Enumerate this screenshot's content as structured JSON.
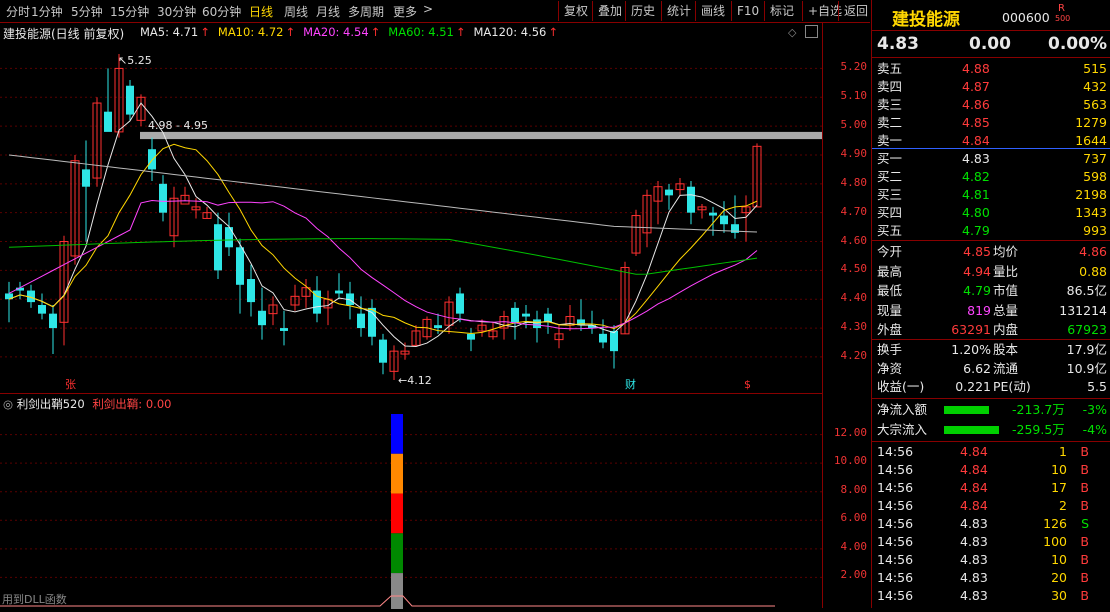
{
  "toolbar": {
    "periods": [
      "分时",
      "1分钟",
      "5分钟",
      "15分钟",
      "30分钟",
      "60分钟",
      "日线",
      "周线",
      "月线",
      "多周期",
      "更多"
    ],
    "active_period": "日线",
    "more_arrow": ">",
    "right_buttons": [
      "复权",
      "叠加",
      "历史",
      "统计",
      "画线",
      "F10",
      "标记",
      "+自选",
      "返回"
    ]
  },
  "chart": {
    "title": "建投能源(日线 前复权)",
    "ma": [
      {
        "label": "MA5: 4.71",
        "arrow": "↑",
        "color": "#e8e8e8"
      },
      {
        "label": "MA10: 4.72",
        "arrow": "↑",
        "color": "#ffd700"
      },
      {
        "label": "MA20: 4.54",
        "arrow": "↑",
        "color": "#ff44ff"
      },
      {
        "label": "MA60: 4.51",
        "arrow": "↑",
        "color": "#00e000"
      },
      {
        "label": "MA120: 4.56",
        "arrow": "↑",
        "color": "#e8e8e8"
      }
    ],
    "annotations": {
      "high": "5.25",
      "range": "4.98 - 4.95",
      "low": "4.12",
      "zhang": "张",
      "cai": "财",
      "dollar": "$"
    },
    "yticks": [
      "5.20",
      "5.10",
      "5.00",
      "4.90",
      "4.80",
      "4.70",
      "4.60",
      "4.50",
      "4.40",
      "4.30",
      "4.20"
    ],
    "ylim": [
      4.12,
      5.25
    ],
    "colors": {
      "up": "#ff3030",
      "down": "#2ee6e6",
      "band": "#aaaaaa"
    }
  },
  "indicator": {
    "title": "利剑出鞘520",
    "value": "利剑出鞘: 0.00",
    "footer": "用到DLL函数",
    "yticks": [
      "12.00",
      "10.00",
      "8.00",
      "6.00",
      "4.00",
      "2.00"
    ],
    "bar_colors": [
      "#0000ff",
      "#ff8800",
      "#ff0000",
      "#008800",
      "#888888"
    ]
  },
  "quote": {
    "name": "建投能源",
    "code": "000600",
    "r_badge": "R",
    "r_sub": "500",
    "price": "4.83",
    "change": "0.00",
    "pct": "0.00%",
    "asks": [
      {
        "label": "卖五",
        "price": "4.88",
        "vol": "515"
      },
      {
        "label": "卖四",
        "price": "4.87",
        "vol": "432"
      },
      {
        "label": "卖三",
        "price": "4.86",
        "vol": "563"
      },
      {
        "label": "卖二",
        "price": "4.85",
        "vol": "1279"
      },
      {
        "label": "卖一",
        "price": "4.84",
        "vol": "1644"
      }
    ],
    "bids": [
      {
        "label": "买一",
        "price": "4.83",
        "vol": "737",
        "pc": "wht"
      },
      {
        "label": "买二",
        "price": "4.82",
        "vol": "598",
        "pc": "green"
      },
      {
        "label": "买三",
        "price": "4.81",
        "vol": "2198",
        "pc": "green"
      },
      {
        "label": "买四",
        "price": "4.80",
        "vol": "1343",
        "pc": "green"
      },
      {
        "label": "买五",
        "price": "4.79",
        "vol": "993",
        "pc": "green"
      }
    ],
    "stats": [
      {
        "l1": "今开",
        "v1": "4.85",
        "c1": "red",
        "l2": "均价",
        "v2": "4.86",
        "c2": "red"
      },
      {
        "l1": "最高",
        "v1": "4.94",
        "c1": "red",
        "l2": "量比",
        "v2": "0.88",
        "c2": "yel"
      },
      {
        "l1": "最低",
        "v1": "4.79",
        "c1": "green",
        "l2": "市值",
        "v2": "86.5亿",
        "c2": "wht"
      },
      {
        "l1": "现量",
        "v1": "819",
        "c1": "mag",
        "l2": "总量",
        "v2": "131214",
        "c2": "wht"
      },
      {
        "l1": "外盘",
        "v1": "63291",
        "c1": "red",
        "l2": "内盘",
        "v2": "67923",
        "c2": "green"
      }
    ],
    "stats2": [
      {
        "l1": "换手",
        "v1": "1.20%",
        "l2": "股本",
        "v2": "17.9亿"
      },
      {
        "l1": "净资",
        "v1": "6.62",
        "l2": "流通",
        "v2": "10.9亿"
      },
      {
        "l1": "收益(一)",
        "v1": "0.221",
        "l2": "PE(动)",
        "v2": "5.5"
      }
    ],
    "flows": [
      {
        "label": "净流入额",
        "value": "-213.7万",
        "pct": "-3%",
        "frac": 0.45
      },
      {
        "label": "大宗流入",
        "value": "-259.5万",
        "pct": "-4%",
        "frac": 0.55
      }
    ],
    "ticks": [
      {
        "t": "14:56",
        "p": "4.84",
        "v": "1",
        "d": "B",
        "pc": "red"
      },
      {
        "t": "14:56",
        "p": "4.84",
        "v": "10",
        "d": "B",
        "pc": "red"
      },
      {
        "t": "14:56",
        "p": "4.84",
        "v": "17",
        "d": "B",
        "pc": "red"
      },
      {
        "t": "14:56",
        "p": "4.84",
        "v": "2",
        "d": "B",
        "pc": "red"
      },
      {
        "t": "14:56",
        "p": "4.83",
        "v": "126",
        "d": "S",
        "pc": "wht"
      },
      {
        "t": "14:56",
        "p": "4.83",
        "v": "100",
        "d": "B",
        "pc": "wht"
      },
      {
        "t": "14:56",
        "p": "4.83",
        "v": "10",
        "d": "B",
        "pc": "wht"
      },
      {
        "t": "14:56",
        "p": "4.83",
        "v": "20",
        "d": "B",
        "pc": "wht"
      },
      {
        "t": "14:56",
        "p": "4.83",
        "v": "30",
        "d": "B",
        "pc": "wht"
      }
    ]
  }
}
